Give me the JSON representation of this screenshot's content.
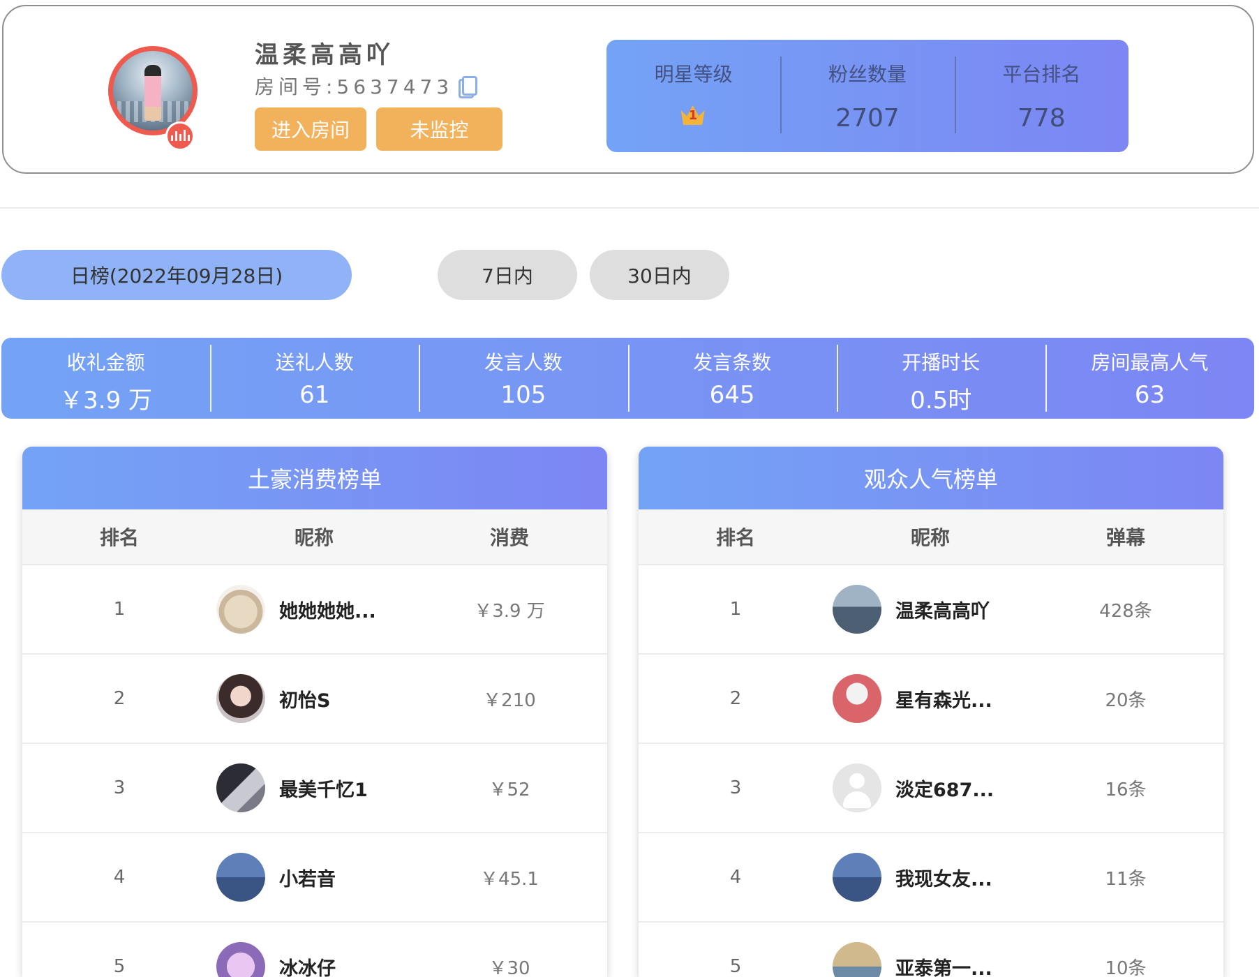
{
  "profile": {
    "name": "温柔高高吖",
    "room_label": "房间号:5637473",
    "enter_button": "进入房间",
    "monitor_button": "未监控"
  },
  "stats": {
    "star_level_label": "明星等级",
    "star_level_icon": "crown-badge-icon",
    "fans_label": "粉丝数量",
    "fans_value": "2707",
    "rank_label": "平台排名",
    "rank_value": "778"
  },
  "tabs": {
    "day": "日榜(2022年09月28日)",
    "week": "7日内",
    "month": "30日内"
  },
  "summary": [
    {
      "label": "收礼金额",
      "value": "￥3.9 万"
    },
    {
      "label": "送礼人数",
      "value": "61"
    },
    {
      "label": "发言人数",
      "value": "105"
    },
    {
      "label": "发言条数",
      "value": "645"
    },
    {
      "label": "开播时长",
      "value": "0.5时"
    },
    {
      "label": "房间最高人气",
      "value": "63"
    }
  ],
  "spend_board": {
    "title": "土豪消费榜单",
    "headers": {
      "rank": "排名",
      "nick": "昵称",
      "value": "消费"
    },
    "rows": [
      {
        "rank": "1",
        "name": "她她她她...",
        "value": "￥3.9 万"
      },
      {
        "rank": "2",
        "name": "初怡S",
        "value": "￥210"
      },
      {
        "rank": "3",
        "name": "最美千忆1",
        "value": "￥52"
      },
      {
        "rank": "4",
        "name": "小若音",
        "value": "￥45.1"
      },
      {
        "rank": "5",
        "name": "冰冰仔",
        "value": "￥30"
      }
    ]
  },
  "popular_board": {
    "title": "观众人气榜单",
    "headers": {
      "rank": "排名",
      "nick": "昵称",
      "value": "弹幕"
    },
    "rows": [
      {
        "rank": "1",
        "name": "温柔高高吖",
        "value": "428条"
      },
      {
        "rank": "2",
        "name": "星有森光...",
        "value": "20条"
      },
      {
        "rank": "3",
        "name": "淡定687...",
        "value": "16条"
      },
      {
        "rank": "4",
        "name": "我现女友...",
        "value": "11条"
      },
      {
        "rank": "5",
        "name": "亚泰第一...",
        "value": "10条"
      }
    ]
  },
  "colors": {
    "accent_gradient_start": "#74a3f5",
    "accent_gradient_end": "#7c86f4",
    "button_orange": "#f2b25c",
    "avatar_ring": "#ee5a4e"
  }
}
